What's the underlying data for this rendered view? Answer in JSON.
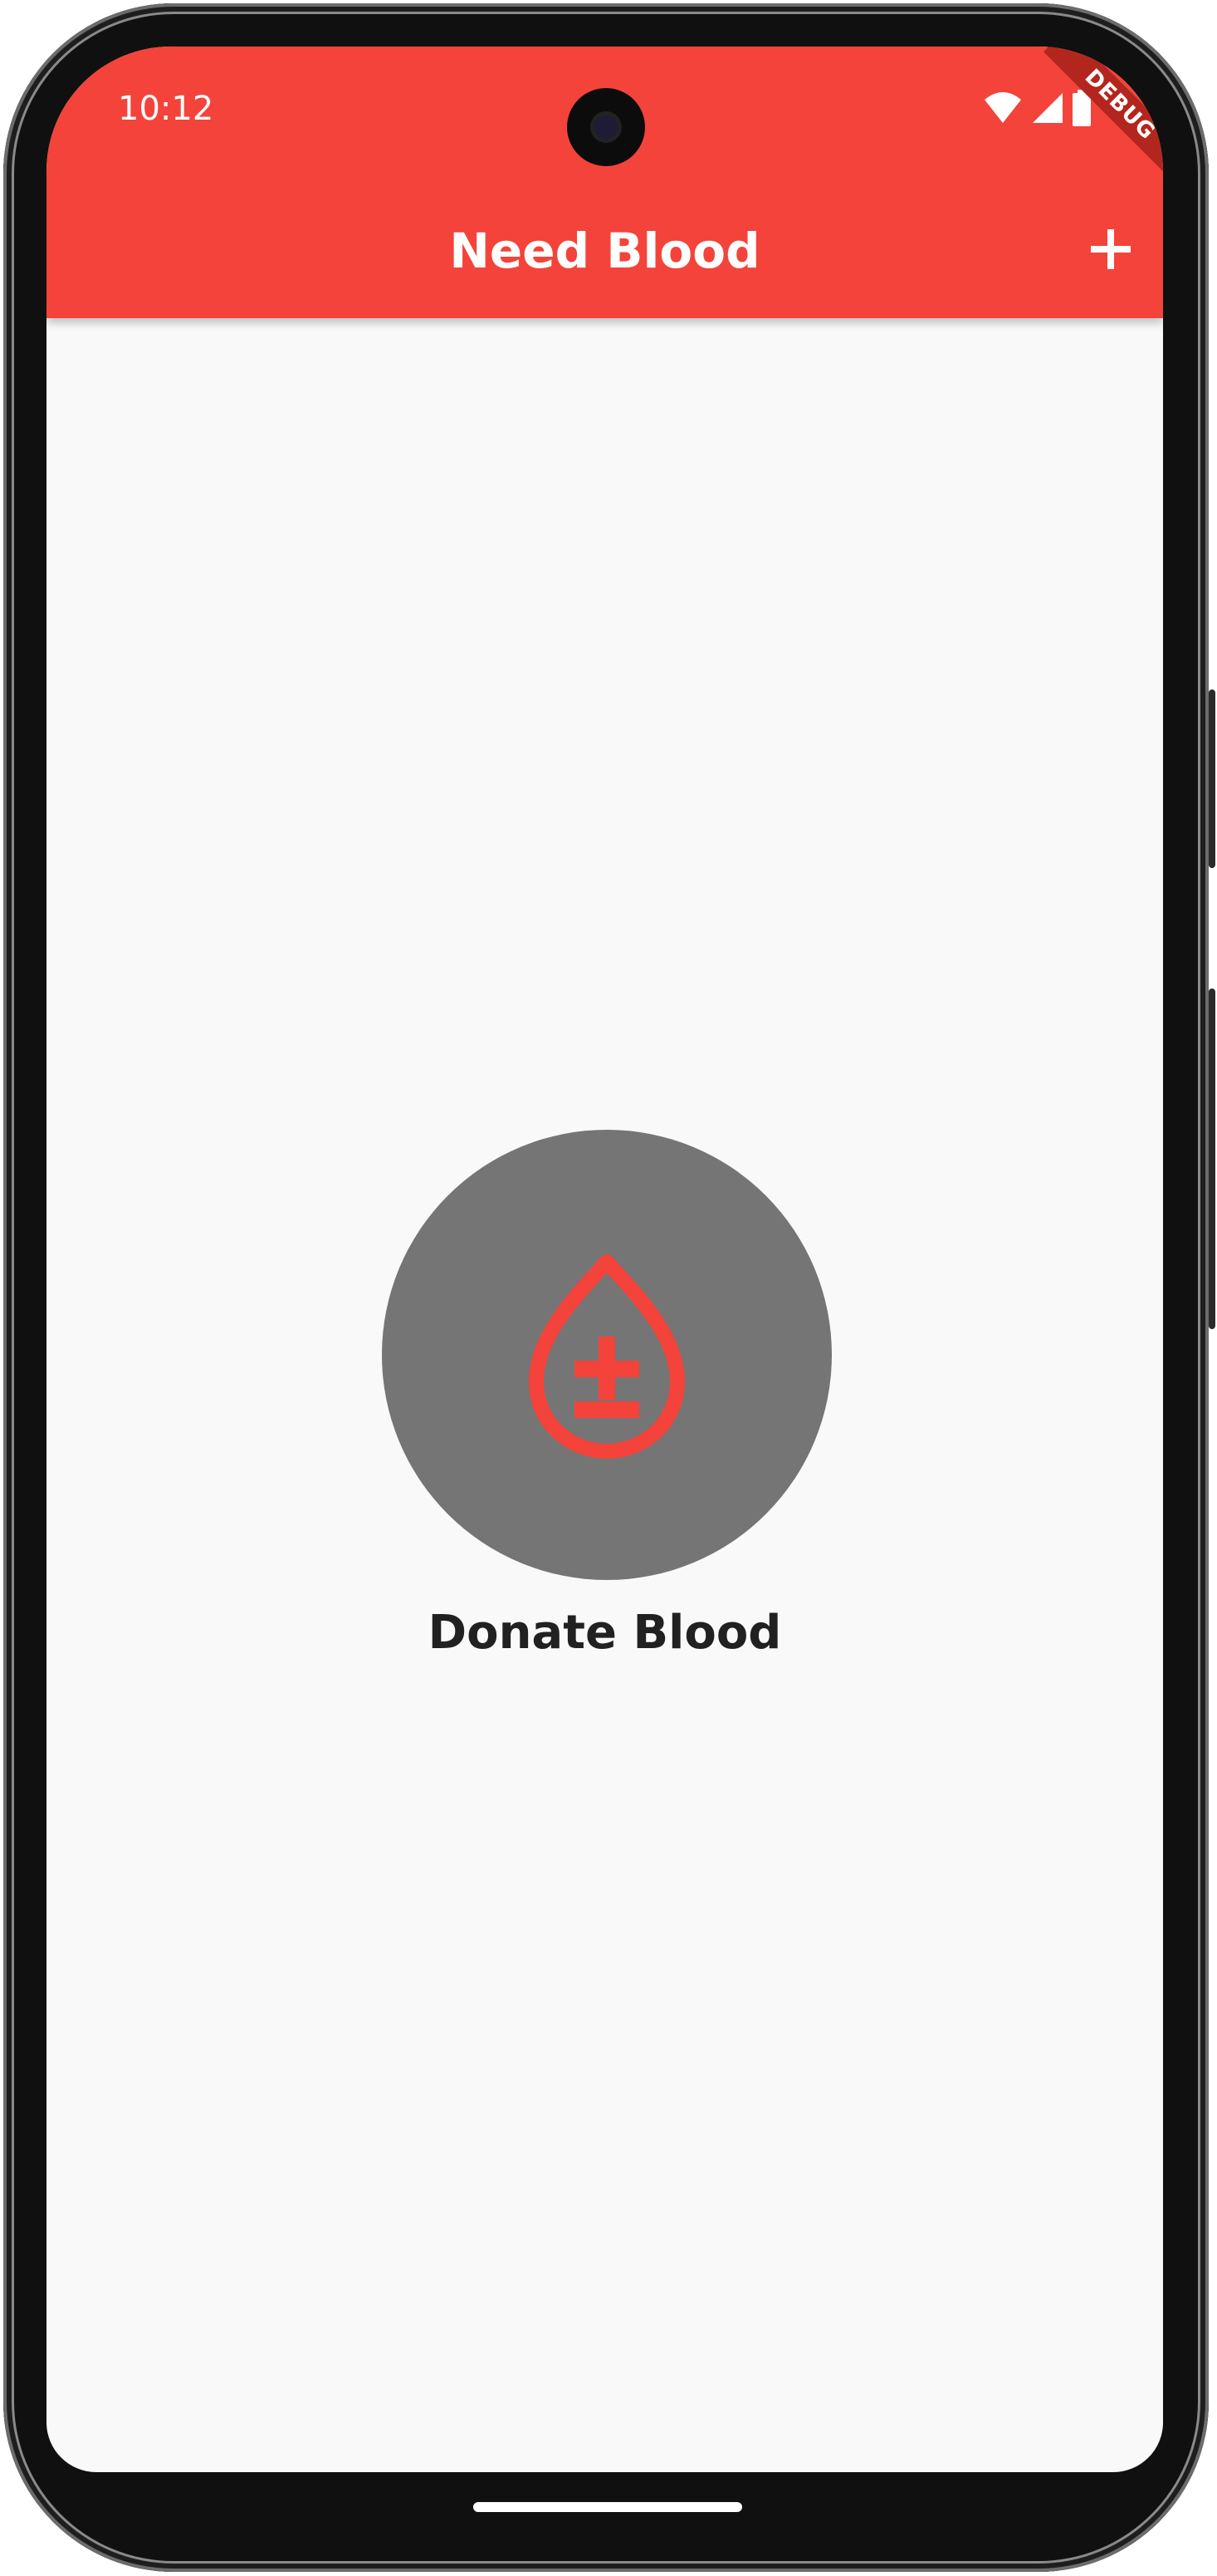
{
  "status_bar": {
    "time": "10:12",
    "debug_banner": "DEBUG"
  },
  "app_bar": {
    "title": "Need Blood",
    "add_icon": "plus-icon"
  },
  "main": {
    "donate_label": "Donate Blood",
    "donate_icon": "blood-drop-plus-minus-icon"
  },
  "colors": {
    "primary": "#f4433a",
    "circle": "#757575",
    "background": "#f9f9f9",
    "label": "#212121"
  }
}
